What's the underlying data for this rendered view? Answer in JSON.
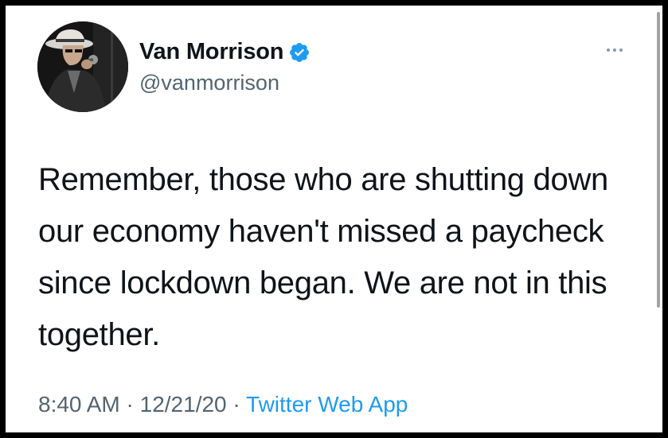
{
  "author": {
    "display_name": "Van Morrison",
    "handle": "@vanmorrison",
    "verified_icon": "verified-badge-icon",
    "avatar_icon": "profile-photo-avatar"
  },
  "menu": {
    "more_icon": "more-options-icon"
  },
  "tweet": {
    "text": "Remember, those who are shutting down our economy haven't missed a paycheck since lockdown began. We are not in this together."
  },
  "meta": {
    "time": "8:40 AM",
    "separator": "·",
    "date": "12/21/20",
    "source": "Twitter Web App"
  },
  "colors": {
    "text_primary": "#0f1419",
    "text_secondary": "#536471",
    "accent": "#1d9bf0",
    "border": "#000000"
  }
}
